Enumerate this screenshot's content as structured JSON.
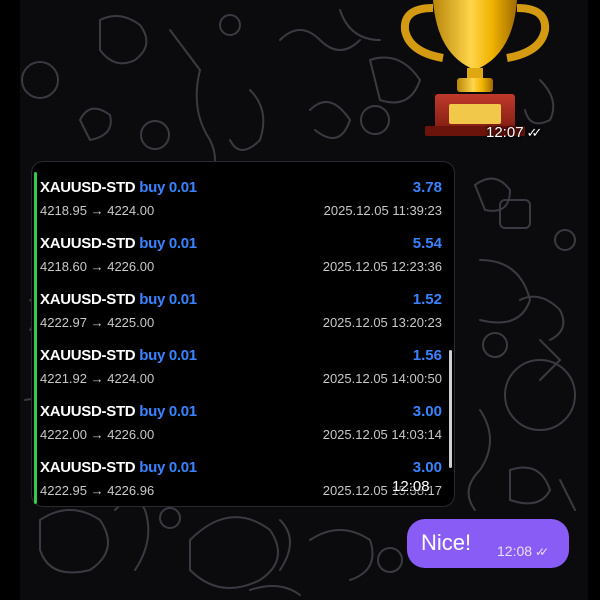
{
  "trophy_message": {
    "time": "12:07",
    "status_icon": "double-check-icon"
  },
  "trades_message": {
    "time": "12:08",
    "trades": [
      {
        "symbol": "XAUUSD-STD",
        "side": "buy 0.01",
        "profit": "3.78",
        "prices": "4218.95 → 4224.00",
        "datetime": "2025.12.05 11:39:23"
      },
      {
        "symbol": "XAUUSD-STD",
        "side": "buy 0.01",
        "profit": "5.54",
        "prices": "4218.60 → 4226.00",
        "datetime": "2025.12.05 12:23:36"
      },
      {
        "symbol": "XAUUSD-STD",
        "side": "buy 0.01",
        "profit": "1.52",
        "prices": "4222.97 → 4225.00",
        "datetime": "2025.12.05 13:20:23"
      },
      {
        "symbol": "XAUUSD-STD",
        "side": "buy 0.01",
        "profit": "1.56",
        "prices": "4221.92 → 4224.00",
        "datetime": "2025.12.05 14:00:50"
      },
      {
        "symbol": "XAUUSD-STD",
        "side": "buy 0.01",
        "profit": "3.00",
        "prices": "4222.00 → 4226.00",
        "datetime": "2025.12.05 14:03:14"
      },
      {
        "symbol": "XAUUSD-STD",
        "side": "buy 0.01",
        "profit": "3.00",
        "prices": "4222.95 → 4226.96",
        "datetime": "2025.12.05 15:38:17"
      }
    ]
  },
  "outgoing_message": {
    "text": "Nice!",
    "time": "12:08",
    "status_icon": "double-check-icon"
  },
  "colors": {
    "background": "#0b0b0d",
    "bubble_outgoing": "#8a5cf6",
    "trade_side": "#3b82ff",
    "profit": "#3b82ff",
    "accent_bar": "#36c84a",
    "doodle": "#3a3a42"
  }
}
